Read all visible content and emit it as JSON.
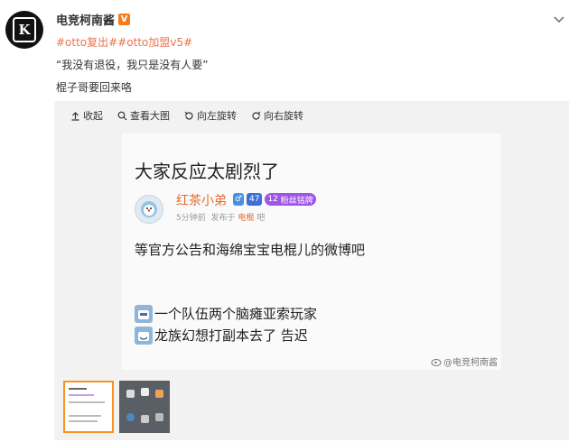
{
  "post": {
    "author": "电竞柯南酱",
    "verified_badge": "V",
    "hashtags": [
      "#otto复出#",
      "#otto加盟v5#"
    ],
    "line1": "“我没有退役，我只是没有人要”",
    "line2": "棍子哥要回来咯"
  },
  "toolbar": {
    "collapse": "收起",
    "view_large": "查看大图",
    "rotate_left": "向左旋转",
    "rotate_right": "向右旋转"
  },
  "screenshot": {
    "title": "大家反应太剧烈了",
    "poster_name": "红茶小弟",
    "gender": "♂",
    "level": "47",
    "fan_badge_level": "12",
    "fan_badge_text": "粉丝铭牌",
    "meta_time": "5分钟前",
    "meta_posted_in": "发布于",
    "meta_board": "电棍",
    "meta_suffix": "吧",
    "body": "等官方公告和海绵宝宝电棍儿的微博吧",
    "comments": [
      "一个队伍两个脑瘫亚索玩家",
      "龙族幻想打副本去了 告迟"
    ],
    "watermark": "@电竞柯南酱"
  },
  "thumbnails": [
    "thumb-1",
    "thumb-2"
  ],
  "colors": {
    "accent_orange": "#eb7350",
    "hashtag": "#eb7350",
    "selected_thumb": "#f7931e"
  }
}
